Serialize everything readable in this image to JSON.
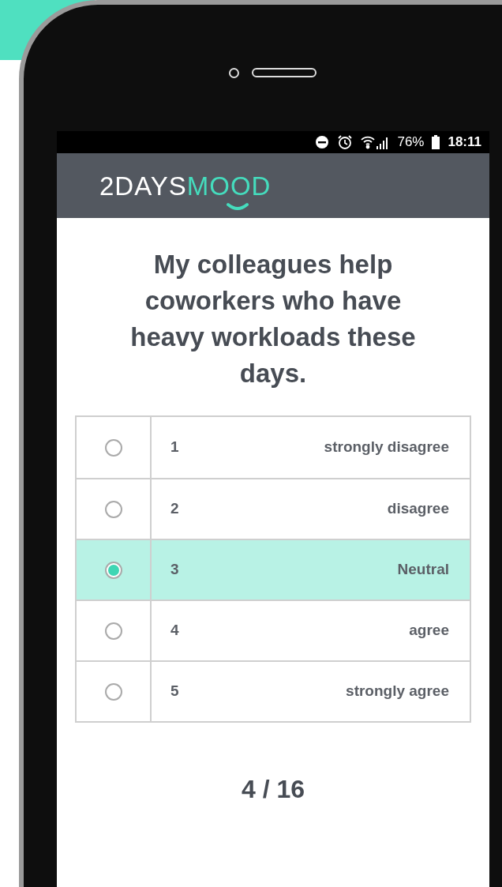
{
  "status_bar": {
    "battery": "76%",
    "time": "18:11"
  },
  "brand": {
    "first": "2DAYS",
    "second": "MOOD"
  },
  "question": "My colleagues help coworkers who have heavy workloads these days.",
  "options": [
    {
      "number": "1",
      "label": "strongly disagree",
      "selected": false
    },
    {
      "number": "2",
      "label": "disagree",
      "selected": false
    },
    {
      "number": "3",
      "label": "Neutral",
      "selected": true
    },
    {
      "number": "4",
      "label": "agree",
      "selected": false
    },
    {
      "number": "5",
      "label": "strongly agree",
      "selected": false
    }
  ],
  "page_counter": "4 / 16"
}
